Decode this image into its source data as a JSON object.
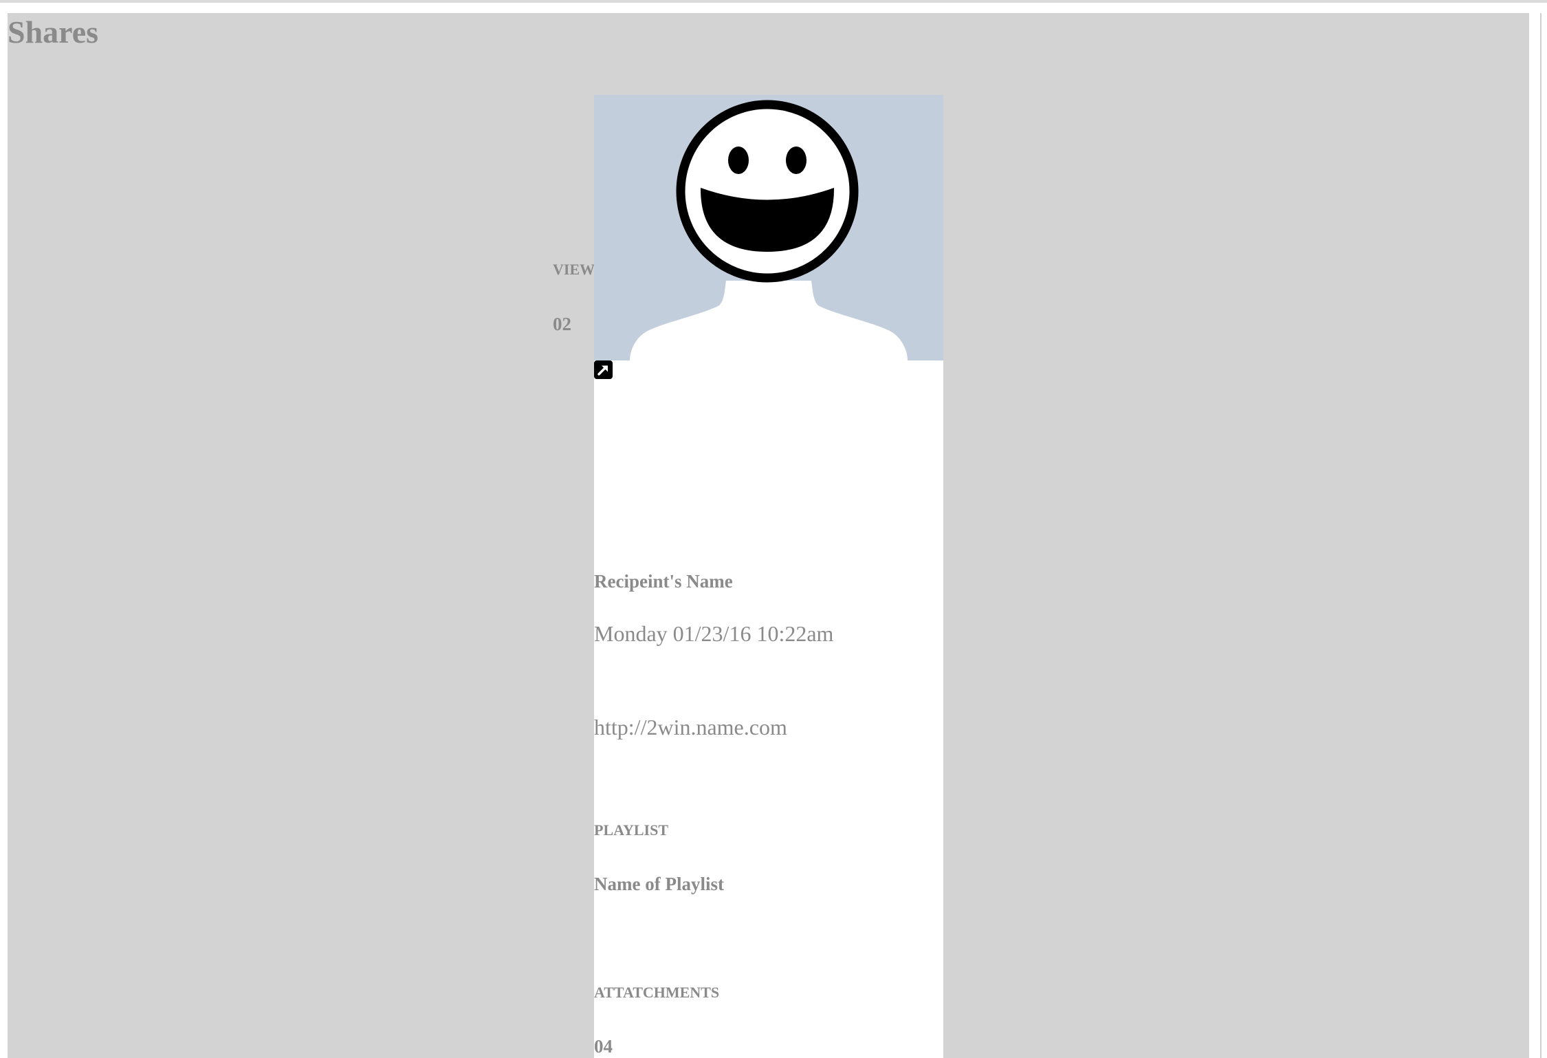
{
  "page": {
    "title": "Shares"
  },
  "share": {
    "view_label": "VIEW",
    "view_count": "02",
    "recipient_name": "Recipeint's Name",
    "date": "Monday 01/23/16 10:22am",
    "url": "http://2win.name.com",
    "playlist_label": "PLAYLIST",
    "playlist_name": "Name of Playlist",
    "attachments_label": "ATTATCHMENTS",
    "attachments_count": "04"
  },
  "icons": {
    "avatar": "smiley-avatar-icon",
    "external_link": "external-link-icon"
  },
  "colors": {
    "panel_background": "#d3d3d3",
    "card_background": "#ffffff",
    "avatar_background": "#c3cedd",
    "text": "#8a8a8a"
  }
}
